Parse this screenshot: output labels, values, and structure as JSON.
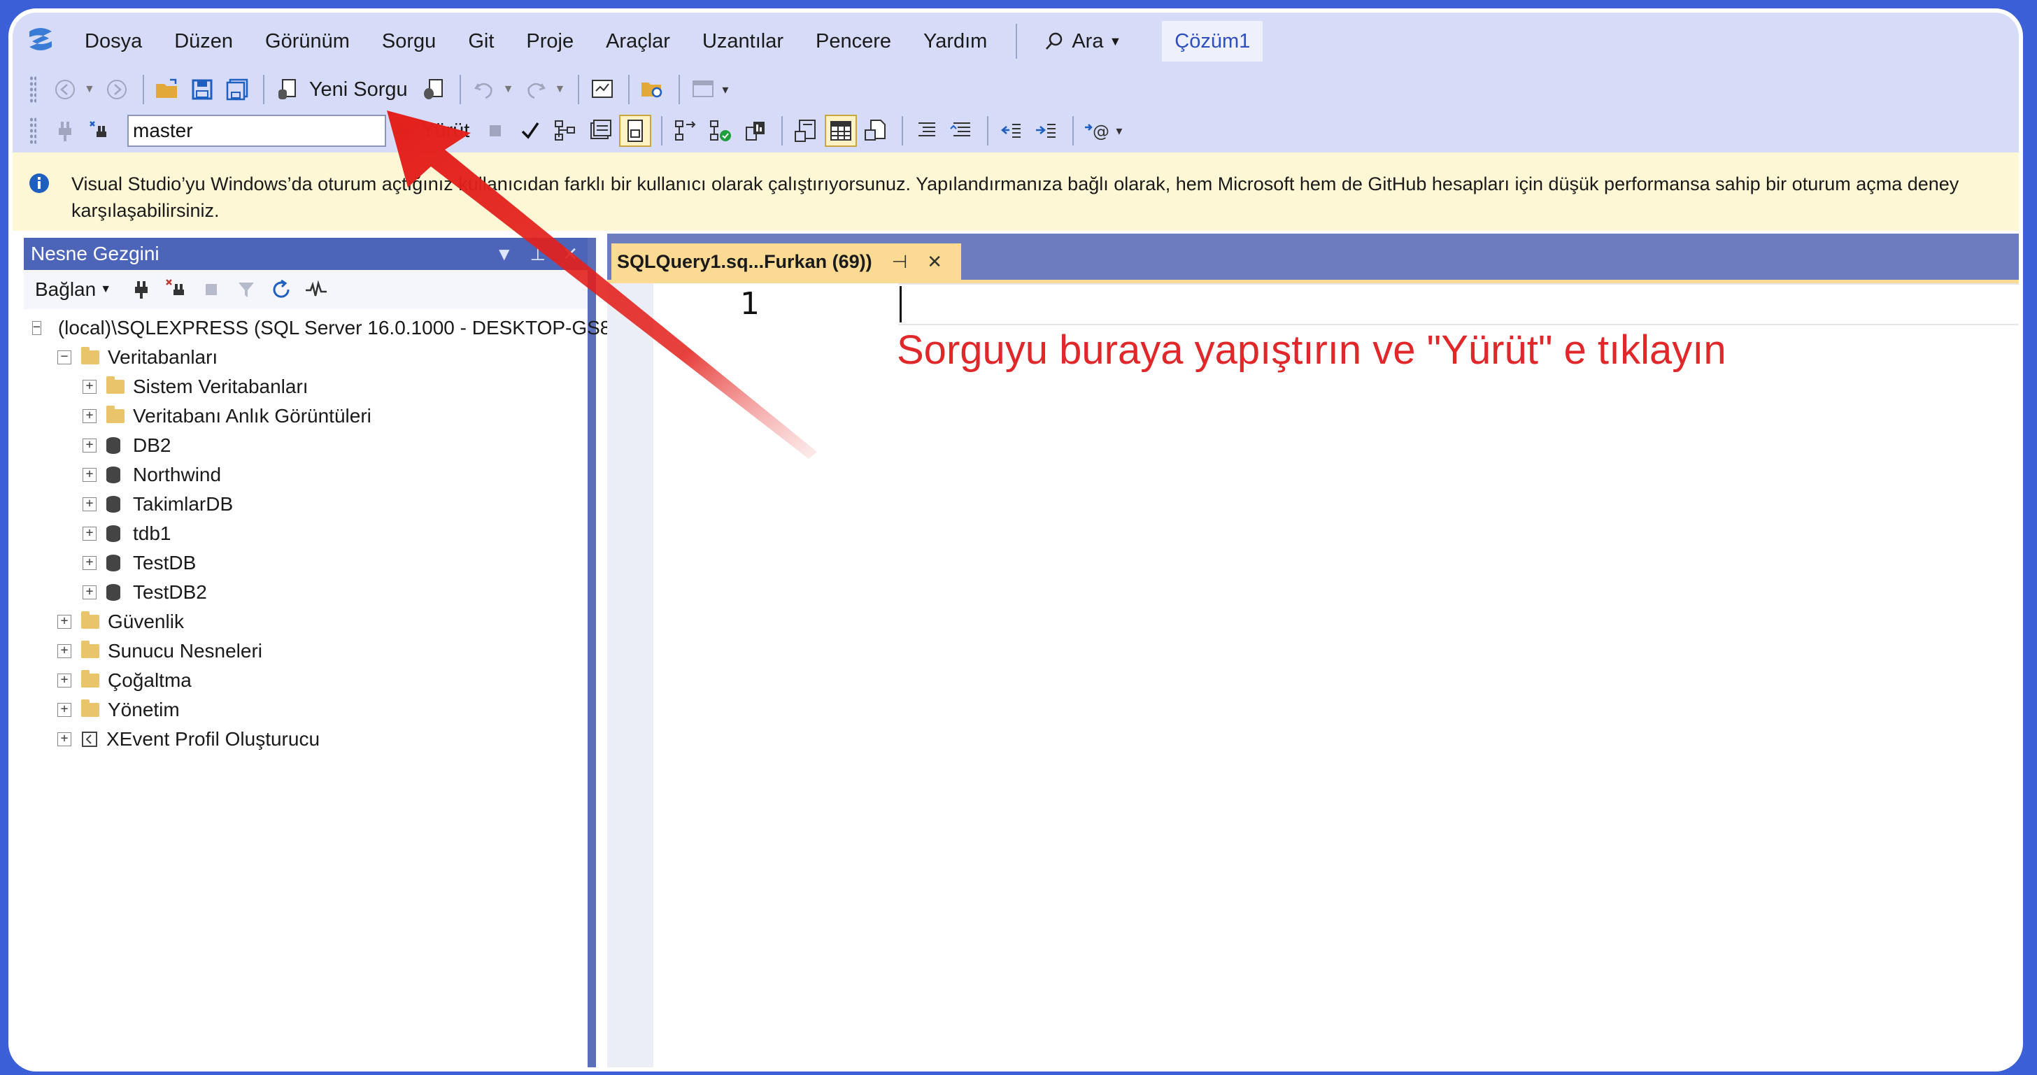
{
  "menubar": {
    "items": [
      "Dosya",
      "Düzen",
      "Görünüm",
      "Sorgu",
      "Git",
      "Proje",
      "Araçlar",
      "Uzantılar",
      "Pencere",
      "Yardım"
    ],
    "search_label": "Ara",
    "solution": "Çözüm1"
  },
  "toolbar": {
    "new_query_label": "Yeni Sorgu",
    "database": "master",
    "execute_label": "Yürüt"
  },
  "infobar": {
    "line1": "Visual Studio’yu Windows’da oturum açtığınız kullanıcıdan farklı bir kullanıcı olarak çalıştırıyorsunuz. Yapılandırmanıza bağlı olarak, hem Microsoft hem de GitHub hesapları için düşük performansa sahip bir oturum açma deney",
    "line2": "karşılaşabilirsiniz."
  },
  "explorer": {
    "title": "Nesne Gezgini",
    "connect_label": "Bağlan",
    "server": "(local)\\SQLEXPRESS (SQL Server 16.0.1000 - DESKTOP-GS8",
    "databases_folder": "Veritabanları",
    "db_children": [
      {
        "label": "Sistem Veritabanları",
        "kind": "folder"
      },
      {
        "label": "Veritabanı Anlık Görüntüleri",
        "kind": "folder"
      },
      {
        "label": "DB2",
        "kind": "db"
      },
      {
        "label": "Northwind",
        "kind": "db"
      },
      {
        "label": "TakimlarDB",
        "kind": "db"
      },
      {
        "label": "tdb1",
        "kind": "db"
      },
      {
        "label": "TestDB",
        "kind": "db"
      },
      {
        "label": "TestDB2",
        "kind": "db"
      }
    ],
    "server_children": [
      "Güvenlik",
      "Sunucu Nesneleri",
      "Çoğaltma",
      "Yönetim"
    ],
    "xevent": "XEvent Profil Oluşturucu"
  },
  "editor": {
    "tab_title": "SQLQuery1.sq...Furkan (69))",
    "line_number": "1",
    "annotation": "Sorguyu buraya yapıştırın ve \"Yürüt\" e tıklayın"
  },
  "colors": {
    "background_frame": "#3b5fd6",
    "chrome": "#d6dcf7",
    "tab_active": "#fbdb93",
    "annotation": "#e0282a"
  }
}
